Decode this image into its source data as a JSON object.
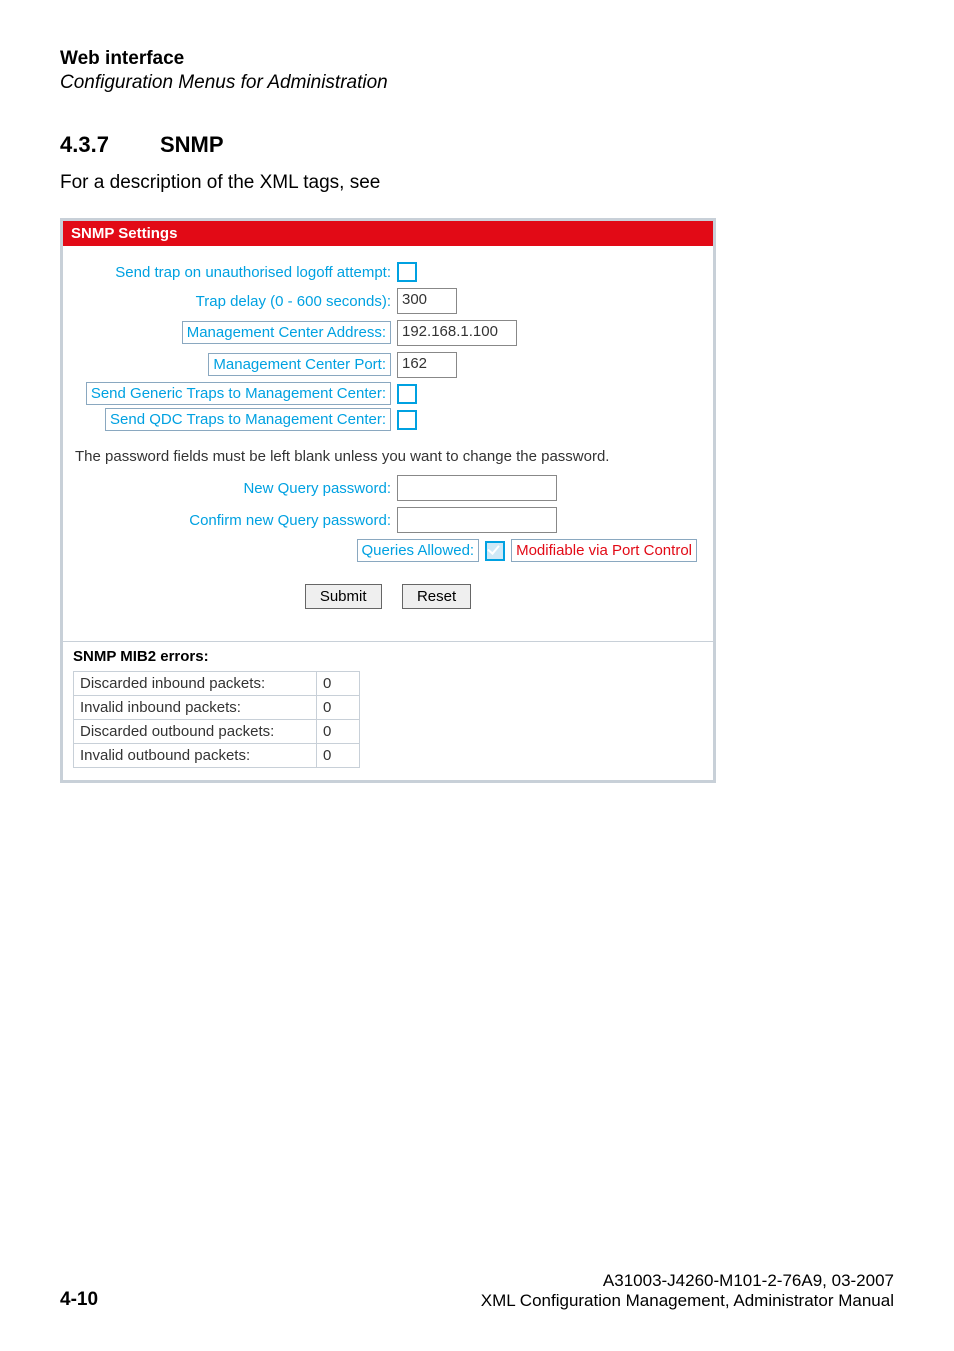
{
  "page_header": {
    "title": "Web interface",
    "subtitle": "Configuration Menus for Administration"
  },
  "section": {
    "number": "4.3.7",
    "title": "SNMP",
    "intro": "For a description of the XML tags, see"
  },
  "panel": {
    "title": "SNMP Settings",
    "labels": {
      "send_trap": "Send trap on unauthorised logoff attempt:",
      "trap_delay": "Trap delay (0 - 600 seconds):",
      "mc_address": "Management Center Address:",
      "mc_port": "Management Center Port:",
      "send_generic": "Send Generic Traps to Management Center:",
      "send_qdc": "Send QDC Traps to Management Center:",
      "new_pw": "New Query password:",
      "confirm_pw": "Confirm new Query password:",
      "queries_allowed": "Queries Allowed:",
      "modifiable_link": "Modifiable via Port Control"
    },
    "values": {
      "send_trap_checked": false,
      "trap_delay": "300",
      "mc_address": "192.168.1.100",
      "mc_port": "162",
      "send_generic_checked": false,
      "send_qdc_checked": false,
      "new_pw": "",
      "confirm_pw": "",
      "queries_allowed_checked": true
    },
    "pw_note": "The password fields must be left blank unless you want to change the password.",
    "buttons": {
      "submit": "Submit",
      "reset": "Reset"
    },
    "errors_title": "SNMP MIB2 errors:",
    "errors": [
      {
        "label": "Discarded inbound packets:",
        "value": "0"
      },
      {
        "label": "Invalid inbound packets:",
        "value": "0"
      },
      {
        "label": "Discarded outbound packets:",
        "value": "0"
      },
      {
        "label": "Invalid outbound packets:",
        "value": "0"
      }
    ]
  },
  "footer": {
    "page_number": "4-10",
    "doc_code": "A31003-J4260-M101-2-76A9, 03-2007",
    "doc_title": "XML Configuration Management, Administrator Manual"
  }
}
